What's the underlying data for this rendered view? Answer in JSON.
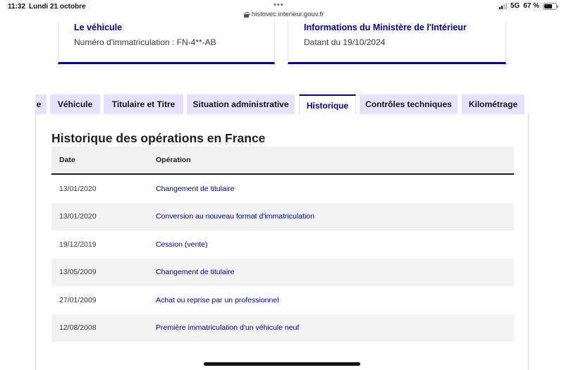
{
  "status_bar": {
    "time": "11:32",
    "date": "Lundi 21 octobre",
    "url": "histovec.interieur.gouv.fr",
    "network": "5G",
    "battery": "67 %",
    "battery_level": 0.67
  },
  "cards": [
    {
      "title": "Le véhicule",
      "text": "Numéro d'immatriculation : FN-4**-AB"
    },
    {
      "title": "Informations du Ministère de l'Intérieur",
      "text": "Datant du 19/10/2024"
    }
  ],
  "tabs": [
    {
      "label": "e"
    },
    {
      "label": "Véhicule"
    },
    {
      "label": "Titulaire et Titre"
    },
    {
      "label": "Situation administrative"
    },
    {
      "label": "Historique",
      "active": true
    },
    {
      "label": "Contrôles techniques"
    },
    {
      "label": "Kilométrage"
    }
  ],
  "panel": {
    "title": "Historique des opérations en France",
    "columns": {
      "date": "Date",
      "operation": "Opération"
    },
    "rows": [
      {
        "date": "13/01/2020",
        "operation": "Changement de titulaire"
      },
      {
        "date": "13/01/2020",
        "operation": "Conversion au nouveau format d'immatriculation"
      },
      {
        "date": "19/12/2019",
        "operation": "Cession (vente)"
      },
      {
        "date": "13/05/2009",
        "operation": "Changement de titulaire"
      },
      {
        "date": "27/01/2009",
        "operation": "Achat ou reprise par un professionnel"
      },
      {
        "date": "12/08/2008",
        "operation": "Première immatriculation d'un véhicule neuf"
      }
    ]
  },
  "colors": {
    "accent": "#000091",
    "tab_bg": "#e3e3fd",
    "row_alt": "#f2f2f2"
  }
}
